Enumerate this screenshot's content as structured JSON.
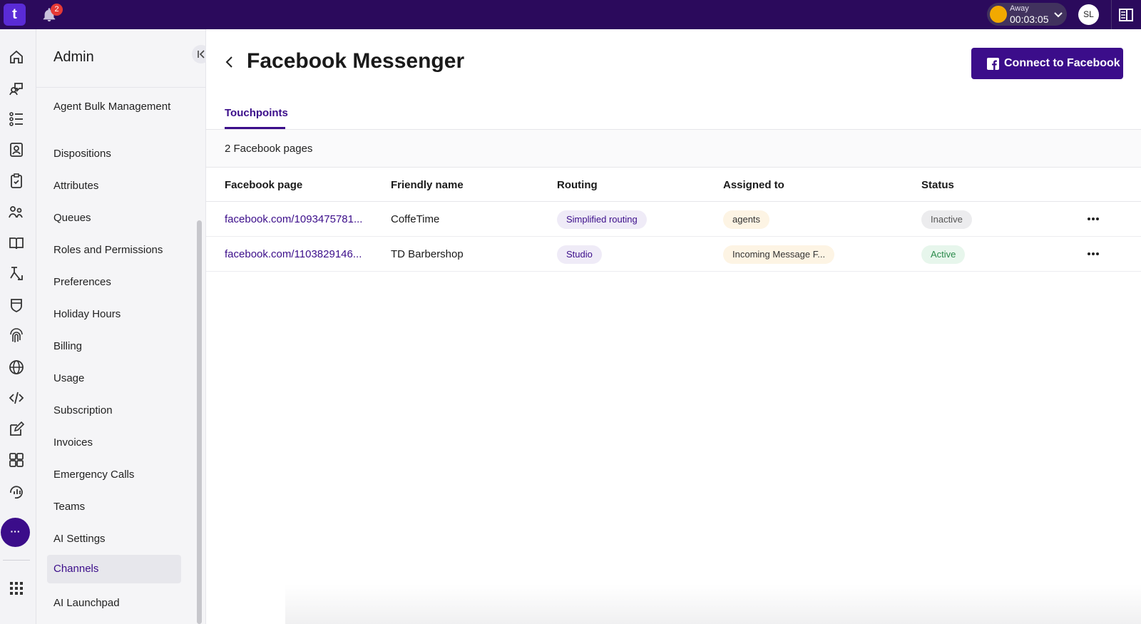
{
  "topbar": {
    "logo_text": "t",
    "notification_count": "2",
    "status": {
      "label": "Away",
      "time": "00:03:05",
      "color": "#f2a900"
    },
    "avatar_initials": "SL"
  },
  "rail": {
    "icons": [
      "home-icon",
      "conversations-icon",
      "list-icon",
      "contacts-icon",
      "tasks-icon",
      "teams-icon",
      "knowledge-icon",
      "workflow-icon",
      "shield-icon",
      "fingerprint-icon",
      "globe-icon",
      "code-icon",
      "edit-icon",
      "grid-icon",
      "analytics-icon"
    ],
    "more_label": "···",
    "apps_icon": "apps-grid-icon"
  },
  "sidebar": {
    "title": "Admin",
    "items": [
      {
        "label": "Agent Bulk Management"
      },
      {
        "label": "Dispositions"
      },
      {
        "label": "Attributes"
      },
      {
        "label": "Queues"
      },
      {
        "label": "Roles and Permissions"
      },
      {
        "label": "Preferences"
      },
      {
        "label": "Holiday Hours"
      },
      {
        "label": "Billing"
      },
      {
        "label": "Usage"
      },
      {
        "label": "Subscription"
      },
      {
        "label": "Invoices"
      },
      {
        "label": "Emergency Calls"
      },
      {
        "label": "Teams"
      },
      {
        "label": "AI Settings"
      },
      {
        "label": "Channels",
        "active": true
      },
      {
        "label": "AI Launchpad"
      }
    ]
  },
  "main": {
    "title": "Facebook Messenger",
    "connect_button": "Connect to Facebook",
    "tabs": [
      {
        "label": "Touchpoints",
        "active": true
      }
    ],
    "count_text": "2 Facebook pages",
    "table": {
      "columns": [
        "Facebook page",
        "Friendly name",
        "Routing",
        "Assigned to",
        "Status"
      ],
      "rows": [
        {
          "page": "facebook.com/1093475781...",
          "name": "CoffeTime",
          "routing": "Simplified routing",
          "assigned": "agents",
          "status": "Inactive"
        },
        {
          "page": "facebook.com/1103829146...",
          "name": "TD Barbershop",
          "routing": "Studio",
          "assigned": "Incoming Message F...",
          "status": "Active"
        }
      ]
    }
  },
  "colors": {
    "brand": "#3b0d8a",
    "topbar": "#2b0a5c",
    "active_status": "#2a8a4a"
  }
}
